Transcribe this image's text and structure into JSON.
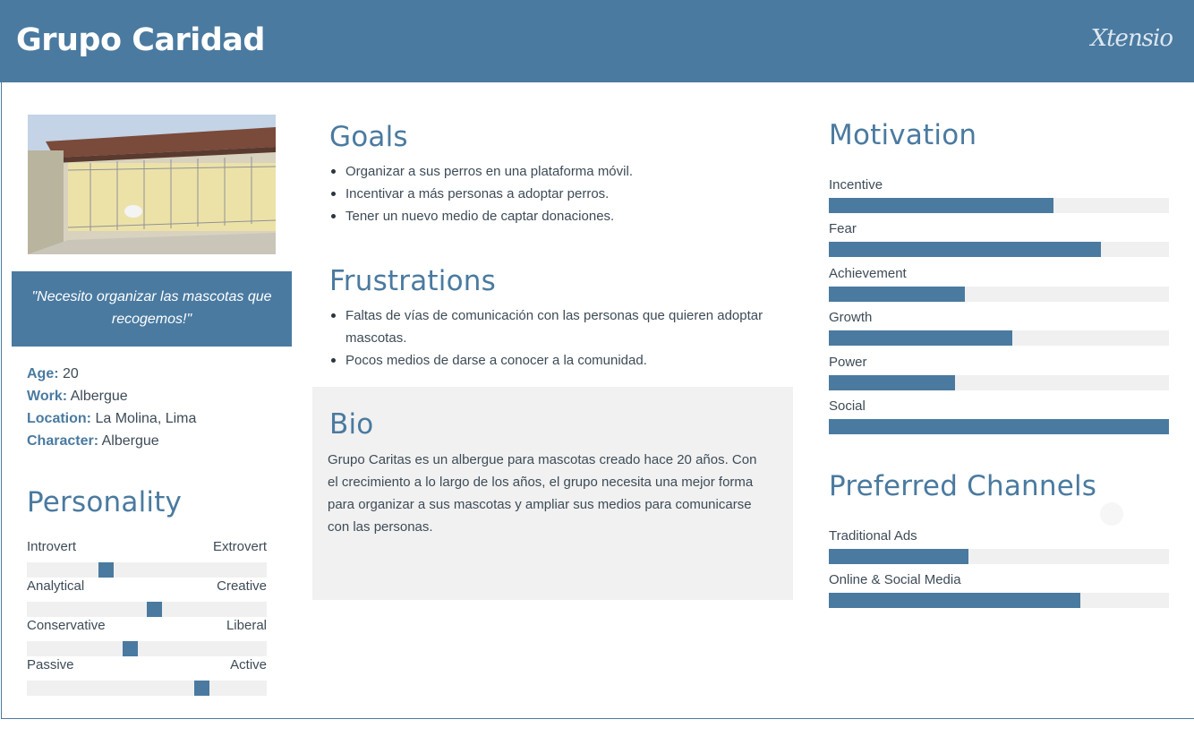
{
  "header": {
    "title": "Grupo Caridad",
    "brand": "Xtensio"
  },
  "profile": {
    "quote": "\"Necesito organizar las mascotas que recogemos!\"",
    "facts": [
      {
        "key": "Age:",
        "value": "20"
      },
      {
        "key": "Work:",
        "value": "Albergue"
      },
      {
        "key": "Location:",
        "value": "La Molina, Lima"
      },
      {
        "key": "Character:",
        "value": "Albergue"
      }
    ]
  },
  "personality": {
    "title": "Personality",
    "scales": [
      {
        "left": "Introvert",
        "right": "Extrovert",
        "value": 0.33
      },
      {
        "left": "Analytical",
        "right": "Creative",
        "value": 0.53
      },
      {
        "left": "Conservative",
        "right": "Liberal",
        "value": 0.43
      },
      {
        "left": "Passive",
        "right": "Active",
        "value": 0.73
      }
    ]
  },
  "goals": {
    "title": "Goals",
    "items": [
      "Organizar a sus perros en una plataforma móvil.",
      "Incentivar a más personas a adoptar perros.",
      "Tener un nuevo medio de captar donaciones."
    ]
  },
  "frustrations": {
    "title": "Frustrations",
    "items": [
      "Faltas de vías de comunicación con las personas que quieren adoptar mascotas.",
      "Pocos medios de darse a conocer a la comunidad."
    ]
  },
  "bio": {
    "title": "Bio",
    "text": "Grupo Caritas es un albergue para mascotas creado hace 20 años. Con el crecimiento a lo largo de los años, el grupo necesita una mejor forma para organizar a sus mascotas y ampliar sus medios para comunicarse con las personas."
  },
  "motivation": {
    "title": "Motivation",
    "items": [
      {
        "label": "Incentive",
        "value": 0.66
      },
      {
        "label": "Fear",
        "value": 0.8
      },
      {
        "label": "Achievement",
        "value": 0.4
      },
      {
        "label": "Growth",
        "value": 0.54
      },
      {
        "label": "Power",
        "value": 0.37
      },
      {
        "label": "Social",
        "value": 1.0
      }
    ]
  },
  "channels": {
    "title": "Preferred Channels",
    "items": [
      {
        "label": "Traditional Ads",
        "value": 0.41
      },
      {
        "label": "Online & Social Media",
        "value": 0.74
      }
    ]
  },
  "colors": {
    "accent": "#4a7aa0",
    "track": "#f0f0f0",
    "bio_bg": "#f1f1f1"
  }
}
